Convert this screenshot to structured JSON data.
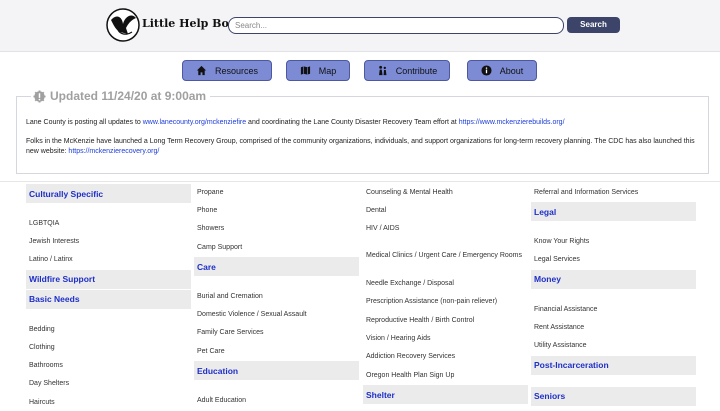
{
  "header": {
    "brand": "Little Help Book",
    "search_placeholder": "Search...",
    "search_button": "Search"
  },
  "nav": [
    {
      "label": "Resources",
      "icon": "home-icon"
    },
    {
      "label": "Map",
      "icon": "map-icon"
    },
    {
      "label": "Contribute",
      "icon": "people-icon"
    },
    {
      "label": "About",
      "icon": "info-icon"
    }
  ],
  "update": {
    "title": "Updated 11/24/20 at 9:00am",
    "p1_pre": "Lane County is posting all updates to ",
    "p1_link1": "www.lanecounty.org/mckenziefire",
    "p1_mid": " and coordinating the Lane County Disaster Recovery Team effort at ",
    "p1_link2": "https://www.mckenzierebuilds.org/",
    "p2_text": "Folks in the McKenzie have launched a Long Term Recovery Group, comprised of the community organizations, individuals, and support organizations for long-term recovery planning. The CDC has also launched this new website: ",
    "p2_link": "https://mckenzierecovery.org/"
  },
  "columns": [
    [
      {
        "label": "Culturally Specific",
        "type": "category"
      },
      {
        "label": "",
        "type": "spacer"
      },
      {
        "label": "LGBTQIA",
        "type": "item"
      },
      {
        "label": "Jewish Interests",
        "type": "item"
      },
      {
        "label": "Latino / Latinx",
        "type": "item"
      },
      {
        "label": "Wildfire Support",
        "type": "category"
      },
      {
        "label": "Basic Needs",
        "type": "category"
      },
      {
        "label": "",
        "type": "spacer"
      },
      {
        "label": "Bedding",
        "type": "item"
      },
      {
        "label": "Clothing",
        "type": "item"
      },
      {
        "label": "Bathrooms",
        "type": "item"
      },
      {
        "label": "Day Shelters",
        "type": "item"
      },
      {
        "label": "Haircuts",
        "type": "item"
      }
    ],
    [
      {
        "label": "Propane",
        "type": "item"
      },
      {
        "label": "Phone",
        "type": "item"
      },
      {
        "label": "Showers",
        "type": "item"
      },
      {
        "label": "Camp Support",
        "type": "item"
      },
      {
        "label": "Care",
        "type": "category"
      },
      {
        "label": "",
        "type": "spacer"
      },
      {
        "label": "Burial and Cremation",
        "type": "item"
      },
      {
        "label": "Domestic Violence / Sexual Assault",
        "type": "item"
      },
      {
        "label": "Family Care Services",
        "type": "item"
      },
      {
        "label": "Pet Care",
        "type": "item"
      },
      {
        "label": "Education",
        "type": "category"
      },
      {
        "label": "",
        "type": "spacer"
      },
      {
        "label": "Adult Education",
        "type": "item"
      }
    ],
    [
      {
        "label": "Counseling & Mental Health",
        "type": "item"
      },
      {
        "label": "Dental",
        "type": "item"
      },
      {
        "label": "HIV / AIDS",
        "type": "item"
      },
      {
        "label": "Medical Clinics / Urgent Care / Emergency Rooms",
        "type": "item2"
      },
      {
        "label": "Needle Exchange / Disposal",
        "type": "item"
      },
      {
        "label": "Prescription Assistance (non-pain reliever)",
        "type": "item"
      },
      {
        "label": "Reproductive Health / Birth Control",
        "type": "item"
      },
      {
        "label": "Vision / Hearing Aids",
        "type": "item"
      },
      {
        "label": "Addiction Recovery Services",
        "type": "item"
      },
      {
        "label": "Oregon Health Plan Sign Up",
        "type": "item"
      },
      {
        "label": "Shelter",
        "type": "category"
      }
    ],
    [
      {
        "label": "Referral and Information Services",
        "type": "item"
      },
      {
        "label": "Legal",
        "type": "category"
      },
      {
        "label": "",
        "type": "spacer"
      },
      {
        "label": "Know Your Rights",
        "type": "item"
      },
      {
        "label": "Legal Services",
        "type": "item"
      },
      {
        "label": "Money",
        "type": "category"
      },
      {
        "label": "",
        "type": "spacer"
      },
      {
        "label": "Financial Assistance",
        "type": "item"
      },
      {
        "label": "Rent Assistance",
        "type": "item"
      },
      {
        "label": "Utility Assistance",
        "type": "item"
      },
      {
        "label": "Post-Incarceration",
        "type": "category"
      },
      {
        "label": "",
        "type": "spacer"
      },
      {
        "label": "Seniors",
        "type": "category"
      }
    ]
  ]
}
